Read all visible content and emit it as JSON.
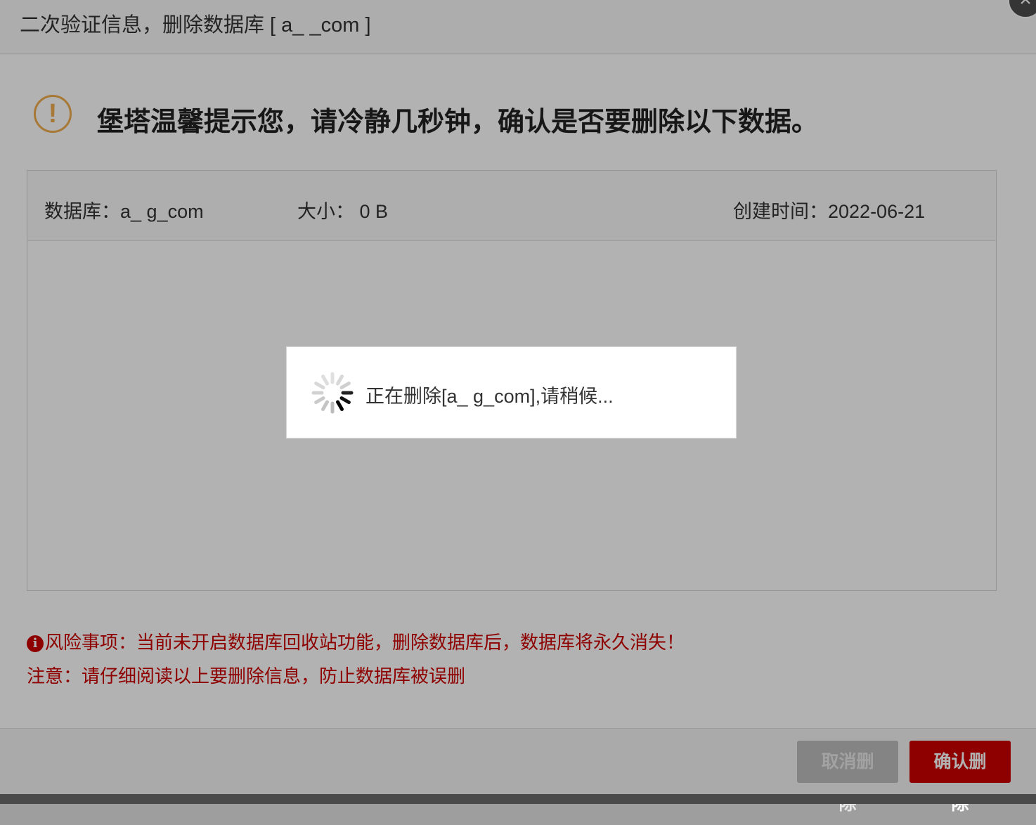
{
  "dialog": {
    "title": "二次验证信息，删除数据库 [ a_        _com ]",
    "close_icon": "×"
  },
  "warning": {
    "icon": "!",
    "heading": "堡塔温馨提示您，请冷静几秒钟，确认是否要删除以下数据。"
  },
  "info": {
    "database_label": "数据库：",
    "database_value": "a_          g_com",
    "size_label": "大小：",
    "size_value": "0 B",
    "created_label": "创建时间：",
    "created_value": "2022-06-21"
  },
  "loading": {
    "text": "正在删除[a_               g_com],请稍候..."
  },
  "risk": {
    "icon": "i",
    "text": "风险事项：当前未开启数据库回收站功能，删除数据库后，数据库将永久消失！"
  },
  "note": {
    "text": "注意：请仔细阅读以上要删除信息，防止数据库被误删"
  },
  "footer": {
    "cancel_label": "取消删除",
    "confirm_label": "确认删除"
  },
  "colors": {
    "danger": "#cc0000",
    "warning": "#f0ad4e"
  }
}
